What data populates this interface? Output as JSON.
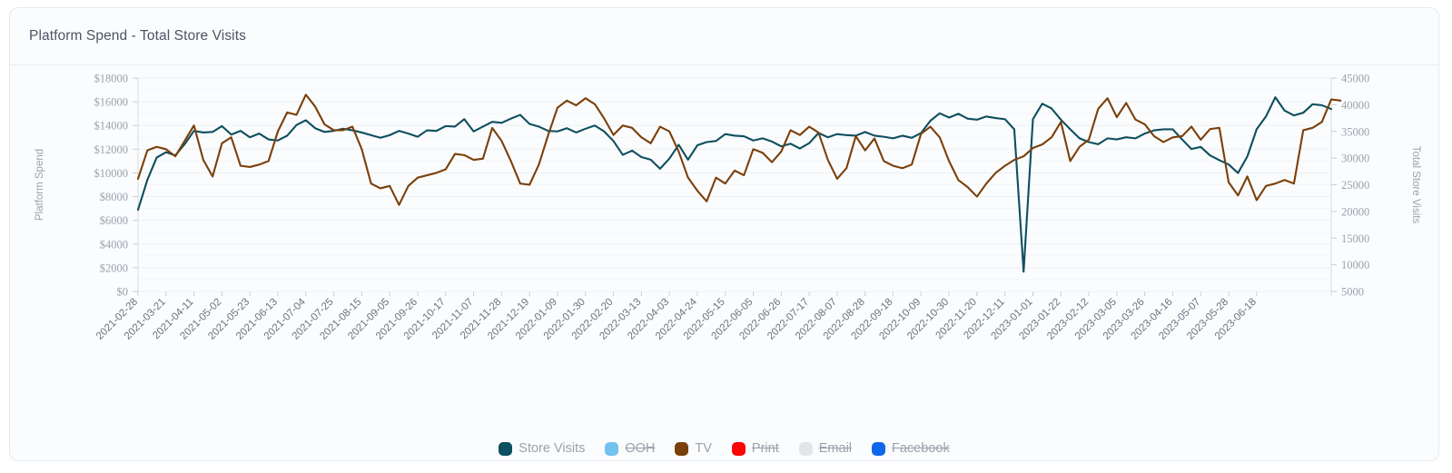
{
  "card": {
    "title": "Platform Spend - Total Store Visits"
  },
  "legend": [
    {
      "label": "Store Visits",
      "color": "#0d4f60",
      "active": true,
      "name": "legend-item-store-visits"
    },
    {
      "label": "OOH",
      "color": "#73c2f0",
      "active": false,
      "name": "legend-item-ooh"
    },
    {
      "label": "TV",
      "color": "#7b3f0a",
      "active": true,
      "name": "legend-item-tv"
    },
    {
      "label": "Print",
      "color": "#fb0505",
      "active": false,
      "name": "legend-item-print"
    },
    {
      "label": "Email",
      "color": "#e3e5e8",
      "active": false,
      "name": "legend-item-email"
    },
    {
      "label": "Facebook",
      "color": "#1167ec",
      "active": false,
      "name": "legend-item-facebook"
    }
  ],
  "chart_data": {
    "type": "line",
    "title": "Platform Spend - Total Store Visits",
    "xlabel": "",
    "ylabel": "Platform Spend",
    "y2label": "Total Store Visits",
    "grid": true,
    "legend_position": "bottom",
    "ylim": [
      0,
      18000
    ],
    "y2lim": [
      5000,
      45000
    ],
    "yticks": [
      "$0",
      "$2000",
      "$4000",
      "$6000",
      "$8000",
      "$10000",
      "$12000",
      "$14000",
      "$16000",
      "$18000"
    ],
    "ytick_values": [
      0,
      2000,
      4000,
      6000,
      8000,
      10000,
      12000,
      14000,
      16000,
      18000
    ],
    "y2ticks": [
      "5000",
      "10000",
      "15000",
      "20000",
      "25000",
      "30000",
      "35000",
      "40000",
      "45000"
    ],
    "y2tick_values": [
      5000,
      10000,
      15000,
      20000,
      25000,
      30000,
      35000,
      40000,
      45000
    ],
    "xtick_labels": [
      "2021-02-28",
      "2021-03-21",
      "2021-04-11",
      "2021-05-02",
      "2021-05-23",
      "2021-06-13",
      "2021-07-04",
      "2021-07-25",
      "2021-08-15",
      "2021-09-05",
      "2021-09-26",
      "2021-10-17",
      "2021-11-07",
      "2021-11-28",
      "2021-12-19",
      "2022-01-09",
      "2022-01-30",
      "2022-02-20",
      "2022-03-13",
      "2022-04-03",
      "2022-04-24",
      "2022-05-15",
      "2022-06-05",
      "2022-06-26",
      "2022-07-17",
      "2022-08-07",
      "2022-08-28",
      "2022-09-18",
      "2022-10-09",
      "2022-10-30",
      "2022-11-20",
      "2022-12-11",
      "2023-01-01",
      "2023-01-22",
      "2023-02-12",
      "2023-03-05",
      "2023-03-26",
      "2023-04-16",
      "2023-05-07",
      "2023-05-28",
      "2023-06-18"
    ],
    "xtick_interval_points": 3,
    "x_start": "2021-02-28",
    "x_end": "2023-06-18",
    "x_step_days": 7,
    "series": [
      {
        "name": "Store Visits",
        "axis": "right",
        "color": "#0d4f60",
        "unit": "visits",
        "values": [
          20300,
          25900,
          30100,
          31100,
          30500,
          32600,
          35100,
          34800,
          34900,
          36000,
          34400,
          35100,
          33900,
          34600,
          33500,
          33300,
          34200,
          36200,
          37100,
          35600,
          34900,
          35100,
          35500,
          35200,
          34800,
          34300,
          33800,
          34300,
          35100,
          34600,
          34000,
          35200,
          35100,
          36000,
          35900,
          37300,
          35000,
          35900,
          36800,
          36600,
          37400,
          38100,
          36400,
          35900,
          35100,
          35000,
          35600,
          34800,
          35500,
          36100,
          35000,
          33200,
          30600,
          31400,
          30200,
          29700,
          28000,
          29900,
          32500,
          29700,
          32400,
          33000,
          33200,
          34500,
          34200,
          34100,
          33300,
          33700,
          33100,
          32200,
          32700,
          31800,
          32800,
          34700,
          33900,
          34500,
          34300,
          34200,
          34900,
          34200,
          34000,
          33700,
          34200,
          33800,
          34700,
          37000,
          38400,
          37600,
          38300,
          37400,
          37200,
          37800,
          37500,
          37300,
          35400,
          8700,
          37300,
          40200,
          39300,
          37200,
          35400,
          33700,
          33000,
          32600,
          33700,
          33500,
          33900,
          33700,
          34600,
          35200,
          35400,
          35400,
          33500,
          31700,
          32100,
          30500,
          29600,
          28800,
          27200,
          30300,
          35400,
          37800,
          41400,
          38900,
          38000,
          38500,
          40100,
          39900,
          39200
        ]
      },
      {
        "name": "TV",
        "axis": "left",
        "color": "#7b3f0a",
        "unit": "dollars",
        "values": [
          9500,
          11900,
          12200,
          12000,
          11400,
          12700,
          14000,
          11100,
          9700,
          12500,
          13000,
          10600,
          10500,
          10700,
          11000,
          13500,
          15100,
          14900,
          16600,
          15600,
          14100,
          13600,
          13600,
          13900,
          12000,
          9100,
          8700,
          8900,
          7300,
          8900,
          9600,
          9800,
          10000,
          10300,
          11600,
          11500,
          11100,
          11200,
          13800,
          12700,
          11000,
          9100,
          9000,
          10700,
          13200,
          15500,
          16100,
          15700,
          16300,
          15800,
          14600,
          13200,
          14000,
          13800,
          13000,
          12500,
          13900,
          13500,
          11800,
          9600,
          8500,
          7600,
          9600,
          9100,
          10200,
          9800,
          12000,
          11700,
          10900,
          11800,
          13600,
          13200,
          13900,
          13400,
          11100,
          9500,
          10400,
          13100,
          11900,
          12900,
          11000,
          10600,
          10400,
          10700,
          13300,
          13900,
          13000,
          11000,
          9400,
          8800,
          8000,
          9100,
          10000,
          10600,
          11100,
          11400,
          12100,
          12400,
          13000,
          14300,
          11000,
          12200,
          12800,
          15400,
          16300,
          14700,
          15900,
          14500,
          14100,
          13100,
          12600,
          13000,
          13100,
          13900,
          12800,
          13700,
          13800,
          9200,
          8100,
          9700,
          7700,
          8900,
          9100,
          9400,
          9100,
          13600,
          13800,
          14300,
          16200,
          16100
        ]
      }
    ]
  }
}
